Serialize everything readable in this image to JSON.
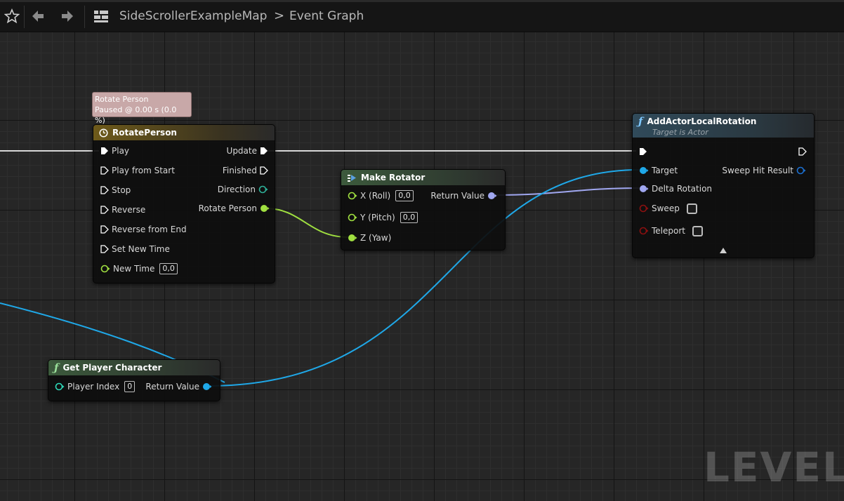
{
  "toolbar": {
    "breadcrumb": {
      "graph_name": "SideScrollerExampleMap",
      "separator": ">",
      "page": "Event Graph"
    }
  },
  "watermark": "LEVEL",
  "comment": {
    "line1": "Rotate Person",
    "line2": "Paused @ 0.00 s (0.0 %)"
  },
  "nodes": {
    "rotate_person": {
      "title": "RotatePerson",
      "inputs": [
        "Play",
        "Play from Start",
        "Stop",
        "Reverse",
        "Reverse from End",
        "Set New Time"
      ],
      "new_time_label": "New Time",
      "new_time_value": "0,0",
      "outputs": [
        "Update",
        "Finished",
        "Direction",
        "Rotate Person"
      ]
    },
    "make_rotator": {
      "title": "Make Rotator",
      "x_label": "X (Roll)",
      "x_value": "0,0",
      "y_label": "Y (Pitch)",
      "y_value": "0,0",
      "z_label": "Z (Yaw)",
      "output": "Return Value"
    },
    "add_actor_local_rotation": {
      "title": "AddActorLocalRotation",
      "subtitle": "Target is Actor",
      "target": "Target",
      "delta": "Delta Rotation",
      "sweep": "Sweep",
      "teleport": "Teleport",
      "output": "Sweep Hit Result"
    },
    "get_player_character": {
      "title": "Get Player Character",
      "input_label": "Player Index",
      "input_value": "0",
      "output": "Return Value"
    }
  },
  "colors": {
    "exec": "#ffffff",
    "float": "#a0e040",
    "object": "#1fa8e8",
    "rotator": "#a0a7f0",
    "bool": "#8c1010",
    "byte": "#2eb29a",
    "timeline_header": "#6e5a1a",
    "pure_header": "#3c5a3c",
    "function_header": "#304a5a"
  }
}
